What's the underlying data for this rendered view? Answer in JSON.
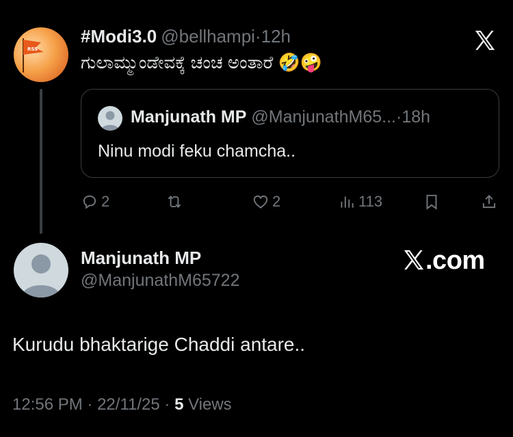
{
  "parent_tweet": {
    "display_name": "#Modi3.0",
    "handle": "@bellhampi",
    "separator": "·",
    "time": "12h",
    "text": "ಗುಲಾಮ್ಮುಂಡೇವಕ್ಕೆ ಚಂಚ ಅಂತಾರೆ",
    "emojis": "🤣🤪",
    "avatar_badge": "RSS",
    "platform_icon": "x-logo-icon"
  },
  "quoted_tweet": {
    "display_name": "Manjunath MP",
    "handle": "@ManjunathM65...",
    "separator": "·",
    "time": "18h",
    "text": "Ninu modi feku chamcha.."
  },
  "actions": {
    "replies": "2",
    "retweets": "",
    "likes": "2",
    "views": "113"
  },
  "reply_tweet": {
    "display_name": "Manjunath MP",
    "handle": "@ManjunathM65722",
    "text": "Kurudu bhaktarige Chaddi antare..",
    "time": "12:56 PM",
    "separator": "·",
    "date": "22/11/25",
    "views_count": "5",
    "views_label": "Views"
  },
  "watermark": {
    "suffix": ".com"
  },
  "colors": {
    "background": "#000000",
    "text": "#e7e9ea",
    "muted": "#71767b",
    "border": "#3a3d41",
    "default_avatar": "#cfd9de"
  }
}
